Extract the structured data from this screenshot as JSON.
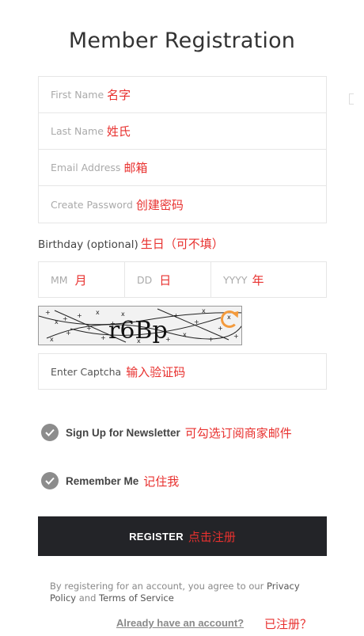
{
  "page": {
    "title": "Member Registration"
  },
  "form": {
    "first_name": {
      "placeholder": "First Name",
      "annotation": "名字"
    },
    "last_name": {
      "placeholder": "Last Name",
      "annotation": "姓氏"
    },
    "email": {
      "placeholder": "Email Address",
      "annotation": "邮箱"
    },
    "password": {
      "placeholder": "Create Password",
      "annotation": "创建密码"
    },
    "birthday": {
      "label": "Birthday (optional)",
      "annotation": "生日（可不填）",
      "month": {
        "placeholder": "MM",
        "annotation": "月"
      },
      "day": {
        "placeholder": "DD",
        "annotation": "日"
      },
      "year": {
        "placeholder": "YYYY",
        "annotation": "年"
      }
    },
    "captcha": {
      "image_text": "r6Bp",
      "input_placeholder": "Enter Captcha",
      "annotation": "输入验证码"
    },
    "newsletter": {
      "label": "Sign Up for Newsletter",
      "annotation": "可勾选订阅商家邮件",
      "checked": true
    },
    "remember": {
      "label": "Remember Me",
      "annotation": "记住我",
      "checked": true
    },
    "submit": {
      "label": "REGISTER",
      "annotation": "点击注册"
    }
  },
  "terms": {
    "prefix": "By registering for an account, you agree to our ",
    "privacy_link": "Privacy Policy",
    "middle": " and ",
    "terms_link": "Terms of Service"
  },
  "login": {
    "link": "Already have an account?",
    "annotation": "已注册？"
  },
  "colors": {
    "annotation": "#e8312f",
    "button": "#232428",
    "check": "#8c8c8c"
  }
}
